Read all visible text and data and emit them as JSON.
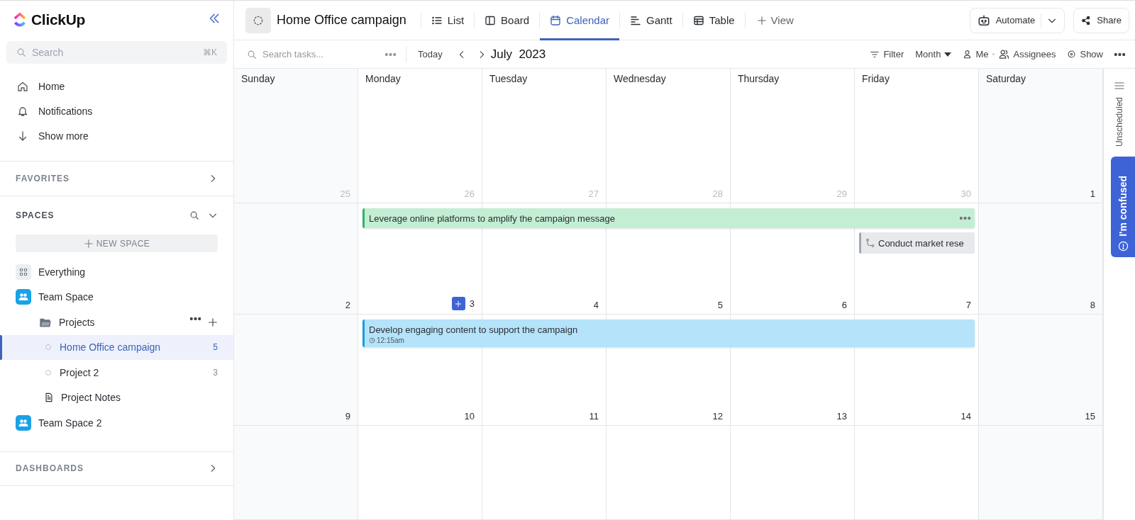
{
  "sidebar": {
    "logo": "ClickUp",
    "search": {
      "placeholder": "Search",
      "shortcut": "⌘K"
    },
    "nav": [
      {
        "label": "Home",
        "kind": "home"
      },
      {
        "label": "Notifications",
        "kind": "bell"
      },
      {
        "label": "Show more",
        "kind": "more"
      }
    ],
    "favorites": {
      "title": "FAVORITES"
    },
    "spaces": {
      "title": "SPACES",
      "new_space": "NEW SPACE",
      "items": [
        {
          "kind": "everything",
          "label": "Everything",
          "selected": false
        },
        {
          "kind": "space",
          "label": "Team Space",
          "selected": false,
          "children": [
            {
              "kind": "folder",
              "label": "Projects",
              "selected": false,
              "children": [
                {
                  "kind": "list",
                  "label": "Home Office campaign",
                  "count": "5",
                  "selected": true
                },
                {
                  "kind": "list",
                  "label": "Project 2",
                  "count": "3",
                  "selected": false
                },
                {
                  "kind": "doc",
                  "label": "Project Notes",
                  "selected": false
                }
              ]
            }
          ]
        },
        {
          "kind": "space",
          "label": "Team Space 2",
          "selected": false
        }
      ]
    },
    "dashboards": {
      "title": "DASHBOARDS"
    }
  },
  "header": {
    "title": "Home Office campaign",
    "tabs": [
      {
        "label": "List",
        "selected": false
      },
      {
        "label": "Board",
        "selected": false
      },
      {
        "label": "Calendar",
        "selected": true
      },
      {
        "label": "Gantt",
        "selected": false
      },
      {
        "label": "Table",
        "selected": false
      }
    ],
    "add_view": "View",
    "automate": "Automate",
    "share": "Share"
  },
  "toolbar": {
    "search_placeholder": "Search tasks...",
    "today": "Today",
    "month_label": "July  2023",
    "filter": "Filter",
    "mode": "Month",
    "me": "Me",
    "assignees": "Assignees",
    "show": "Show"
  },
  "calendar": {
    "weekdays": [
      "Sunday",
      "Monday",
      "Tuesday",
      "Wednesday",
      "Thursday",
      "Friday",
      "Saturday"
    ],
    "weeks": [
      {
        "days": [
          {
            "number": "25",
            "other_month": true
          },
          {
            "number": "26",
            "other_month": true
          },
          {
            "number": "27",
            "other_month": true
          },
          {
            "number": "28",
            "other_month": true
          },
          {
            "number": "29",
            "other_month": true
          },
          {
            "number": "30",
            "other_month": true
          },
          {
            "number": "1",
            "other_month": false
          }
        ]
      },
      {
        "days": [
          {
            "number": "2",
            "other_month": false
          },
          {
            "number": "3",
            "other_month": false,
            "add_button": true
          },
          {
            "number": "4",
            "other_month": false
          },
          {
            "number": "5",
            "other_month": false
          },
          {
            "number": "6",
            "other_month": false
          },
          {
            "number": "7",
            "other_month": false
          },
          {
            "number": "8",
            "other_month": false
          }
        ],
        "events": [
          {
            "kind": "task",
            "title": "Leverage online platforms to amplify the campaign message",
            "covers": [
              false,
              true,
              true,
              true,
              true,
              true,
              false
            ],
            "color": "#c3eed3"
          },
          {
            "kind": "subtask",
            "title": "Conduct market rese",
            "covers": [
              false,
              false,
              false,
              false,
              false,
              true,
              false
            ],
            "color": "#e7e9ec"
          }
        ]
      },
      {
        "days": [
          {
            "number": "9",
            "other_month": false
          },
          {
            "number": "10",
            "other_month": false
          },
          {
            "number": "11",
            "other_month": false
          },
          {
            "number": "12",
            "other_month": false
          },
          {
            "number": "13",
            "other_month": false
          },
          {
            "number": "14",
            "other_month": false
          },
          {
            "number": "15",
            "other_month": false
          }
        ],
        "events": [
          {
            "kind": "task",
            "title": "Develop engaging content to support the campaign",
            "time": "12:15am",
            "covers": [
              false,
              true,
              true,
              true,
              true,
              true,
              false
            ],
            "color": "#b5e3f9"
          }
        ]
      }
    ]
  },
  "rail": {
    "unscheduled": "Unscheduled",
    "help": "I'm confused"
  }
}
